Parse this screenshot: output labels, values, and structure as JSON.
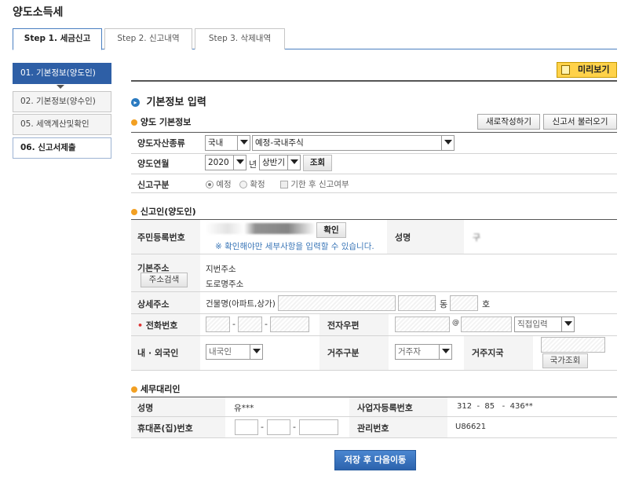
{
  "page_title": "양도소득세",
  "tabs": [
    "Step 1. 세금신고",
    "Step 2. 신고내역",
    "Step 3. 삭제내역"
  ],
  "sidebar": [
    "01. 기본정보(양도인)",
    "02. 기본정보(양수인)",
    "05. 세액계산및확인",
    "06. 신고서제출"
  ],
  "preview_label": "미리보기",
  "section_title": "기본정보 입력",
  "transfer_info": {
    "heading": "양도 기본정보",
    "new_button": "새로작성하기",
    "load_button": "신고서 불러오기",
    "asset_type_label": "양도자산종류",
    "asset_domestic": "국내",
    "asset_kind": "예정-국내주식",
    "period_label": "양도연월",
    "year": "2020",
    "year_unit": "년",
    "half": "상반기",
    "lookup_button": "조회",
    "filing_type_label": "신고구분",
    "radio_scheduled": "예정",
    "radio_confirmed": "확정",
    "checkbox_late": "기한 후 신고여부"
  },
  "filer": {
    "heading": "신고인(양도인)",
    "rrn_label": "주민등록번호",
    "confirm_button": "확인",
    "notice": "※ 확인해야만 세부사항을 입력할 수 있습니다.",
    "name_label": "성명",
    "name_value": "구",
    "address_label": "기본주소",
    "address_search": "주소검색",
    "lot_address": "지번주소",
    "road_address": "도로명주소",
    "detail_label": "상세주소",
    "building_label": "건물명(아파트,상가)",
    "dong": "동",
    "ho": "호",
    "phone_label": "전화번호",
    "dash": "-",
    "email_label": "전자우편",
    "at": "@",
    "email_domain": "직접입력",
    "nationality_label": "내 · 외국인",
    "nationality_value": "내국인",
    "residence_label": "거주구분",
    "residence_value": "거주자",
    "country_label": "거주지국",
    "country_button": "국가조회"
  },
  "agent": {
    "heading": "세무대리인",
    "name_label": "성명",
    "name_value": "유***",
    "biz_label": "사업자등록번호",
    "biz_value": "312  -  85   -  436**",
    "mobile_label": "휴대폰(집)번호",
    "mgmt_label": "관리번호",
    "mgmt_value": "U86621"
  },
  "save_button": "저장 후 다음이동"
}
